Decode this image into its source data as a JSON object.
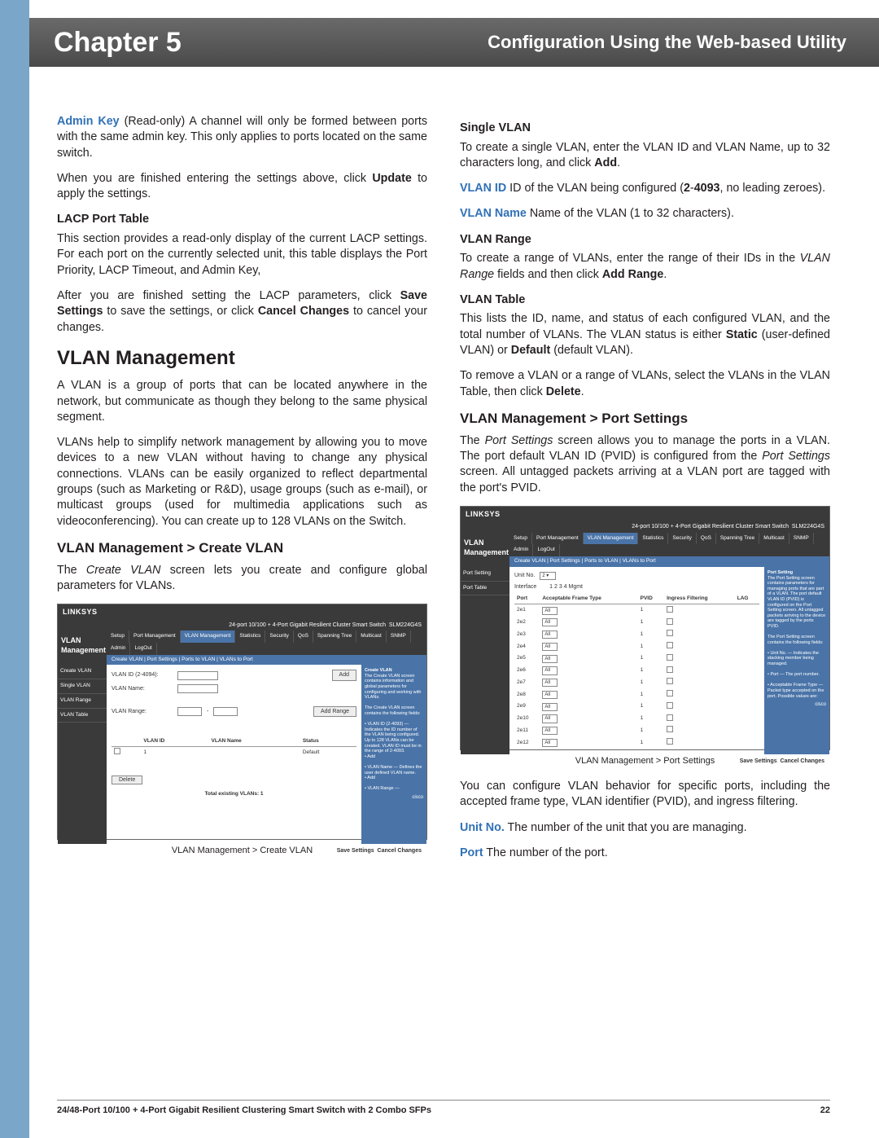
{
  "header": {
    "chapter": "Chapter 5",
    "title": "Configuration Using the Web-based Utility"
  },
  "left": {
    "admin_key_label": "Admin Key",
    "admin_key_text": "  (Read-only) A channel will only be formed between ports with the same admin key. This only applies to ports located on the same switch.",
    "update_para_a": "When you are finished entering the settings above, click ",
    "update_bold": "Update",
    "update_para_b": " to apply the settings.",
    "lacp_table_h": "LACP Port Table",
    "lacp_table_p": "This section provides a read-only display of the current LACP settings. For each port on the currently selected unit, this table displays the Port Priority, LACP Timeout, and Admin Key,",
    "lacp_after_a": "After you are finished setting the LACP parameters, click ",
    "lacp_save": "Save Settings",
    "lacp_after_b": " to save the settings, or click ",
    "lacp_cancel": "Cancel Changes",
    "lacp_after_c": " to cancel your changes.",
    "vlan_h": "VLAN Management",
    "vlan_p1": "A VLAN is a group of ports that can be located anywhere in the network, but communicate as though they belong to the same physical segment.",
    "vlan_p2": "VLANs help to simplify network management by allowing you to move devices to a new VLAN without having to change any physical connections. VLANs can be easily organized to reflect departmental groups (such as Marketing or R&D), usage groups (such as e-mail), or multicast groups (used for multimedia applications such as videoconferencing). You can create up to 128 VLANs on the Switch.",
    "create_h": "VLAN Management > Create VLAN",
    "create_p_a": "The ",
    "create_em": "Create VLAN",
    "create_p_b": " screen lets you create and configure global parameters for VLANs.",
    "fig_cap": "VLAN Management > Create VLAN"
  },
  "right": {
    "single_h": "Single VLAN",
    "single_p_a": "To create a single VLAN, enter the VLAN ID and VLAN Name, up to 32 characters long,  and click ",
    "single_add": "Add",
    "single_p_b": ".",
    "vlanid_label": "VLAN ID",
    "vlanid_text_a": "  ID of the VLAN being configured (",
    "vlanid_range": "2",
    "vlanid_dash": "-",
    "vlanid_range2": "4093",
    "vlanid_text_b": ", no leading zeroes).",
    "vlanname_label": "VLAN Name",
    "vlanname_text": "  Name of the VLAN (1 to 32 characters).",
    "range_h": "VLAN Range",
    "range_p_a": "To create a range of VLANs, enter the range of their IDs in the ",
    "range_em": "VLAN Range",
    "range_p_b": " fields and then click ",
    "range_add": "Add Range",
    "range_p_c": ".",
    "table_h": "VLAN Table",
    "table_p_a": "This lists the ID, name, and status of each configured VLAN, and the total number of VLANs. The VLAN status is either ",
    "table_static": "Static",
    "table_p_b": " (user-defined VLAN) or ",
    "table_default": "Default",
    "table_p_c": " (default VLAN).",
    "table_remove_a": "To remove a VLAN or a range of VLANs, select the VLANs in the VLAN Table, then click ",
    "table_delete": "Delete",
    "table_remove_b": ".",
    "ps_h": "VLAN Management > Port Settings",
    "ps_p_a": "The ",
    "ps_em": "Port Settings",
    "ps_p_b": " screen allows you to manage the ports in a VLAN. The port default VLAN ID (PVID) is configured from the ",
    "ps_em2": "Port Settings",
    "ps_p_c": " screen. All untagged packets arriving at a VLAN port are tagged with the port's PVID.",
    "fig_cap": "VLAN Management > Port Settings",
    "cfg_p": "You can configure VLAN behavior for specific ports, including the accepted frame type, VLAN identifier (PVID), and ingress filtering.",
    "unitno_label": "Unit No.",
    "unitno_text": "   The number of the unit that you are managing.",
    "port_label": "Port",
    "port_text": "  The number of the port."
  },
  "shot1": {
    "brand": "LINKSYS",
    "prod": "24-port 10/100 + 4-Port Gigabit Resilient Cluster Smart Switch",
    "model": "SLM224G4S",
    "section": "VLAN Management",
    "tabs": [
      "Setup",
      "Port Management",
      "VLAN Management",
      "Statistics",
      "Security",
      "QoS",
      "Spanning Tree",
      "Multicast",
      "SNMP",
      "Admin",
      "LogOut"
    ],
    "subtabs": "Create VLAN  |  Port Settings  |  Ports to VLAN  |  VLANs to Port",
    "left_items": [
      "Create VLAN",
      "Single VLAN",
      "",
      "VLAN Range",
      "",
      "VLAN Table"
    ],
    "vlanid_lbl": "VLAN ID (2-4094):",
    "vlanname_lbl": "VLAN Name:",
    "add_btn": "Add",
    "range_lbl": "VLAN Range:",
    "addrange_btn": "Add Range",
    "tbl_hdr": [
      "",
      "VLAN ID",
      "VLAN Name",
      "Status"
    ],
    "tbl_row": [
      "",
      "1",
      "",
      "Default"
    ],
    "delete_btn": "Delete",
    "total": "Total existing VLANs: 1",
    "right_h": "Create VLAN",
    "right_txt": "The Create VLAN screen contains information and global parameters for configuring and working with VLANs.\n\nThe Create VLAN screen contains the following fields:\n\n• VLAN ID (2-4093) — Indicates the ID number of the VLAN being configured. Up to 128 VLANs can be created. VLAN ID must be in the range of 2-4093.\n• Add\n\n• VLAN Name — Defines the user defined VLAN name.\n• Add\n\n• VLAN Range —",
    "save": "Save Settings",
    "cancel": "Cancel Changes",
    "cisco": "cisco"
  },
  "shot2": {
    "brand": "LINKSYS",
    "section": "VLAN Management",
    "tabs": [
      "Setup",
      "Port Management",
      "VLAN Management",
      "Statistics",
      "Security",
      "QoS",
      "Spanning Tree",
      "Multicast",
      "SNMP",
      "Admin",
      "LogOut"
    ],
    "subtabs": "Create VLAN  |  Port Settings  |  Ports to VLAN  |  VLANs to Port",
    "left_items": [
      "Port Setting",
      "Port Table"
    ],
    "unit_lbl": "Unit No.",
    "interface_lbl": "Interface",
    "pages": "1  2  3  4  Mgmt",
    "hdr": [
      "Port",
      "Acceptable Frame Type",
      "PVID",
      "Ingress Filtering",
      "LAG"
    ],
    "rows": [
      [
        "2e1",
        "All",
        "1"
      ],
      [
        "2e2",
        "All",
        "1"
      ],
      [
        "2e3",
        "All",
        "1"
      ],
      [
        "2e4",
        "All",
        "1"
      ],
      [
        "2e5",
        "All",
        "1"
      ],
      [
        "2e6",
        "All",
        "1"
      ],
      [
        "2e7",
        "All",
        "1"
      ],
      [
        "2e8",
        "All",
        "1"
      ],
      [
        "2e9",
        "All",
        "1"
      ],
      [
        "2e10",
        "All",
        "1"
      ],
      [
        "2e11",
        "All",
        "1"
      ],
      [
        "2e12",
        "All",
        "1"
      ]
    ],
    "right_h": "Port Setting",
    "right_txt": "The Port Setting screen contains parameters for managing ports that are part of a VLAN. The port default VLAN ID (PVID) is configured on the Port Setting screen. All untagged packets arriving to the device are tagged by the ports PVID.\n\nThe Port Setting screen contains the following fields:\n\n• Unit No. — Indicates the stacking member being managed.\n\n• Port — The port number.\n\n• Acceptable Frame Type — Packet type accepted on the port. Possible values are:",
    "save": "Save Settings",
    "cancel": "Cancel Changes"
  },
  "footer": {
    "product": "24/48-Port 10/100 + 4-Port Gigabit Resilient Clustering Smart Switch with 2 Combo SFPs",
    "page": "22"
  }
}
